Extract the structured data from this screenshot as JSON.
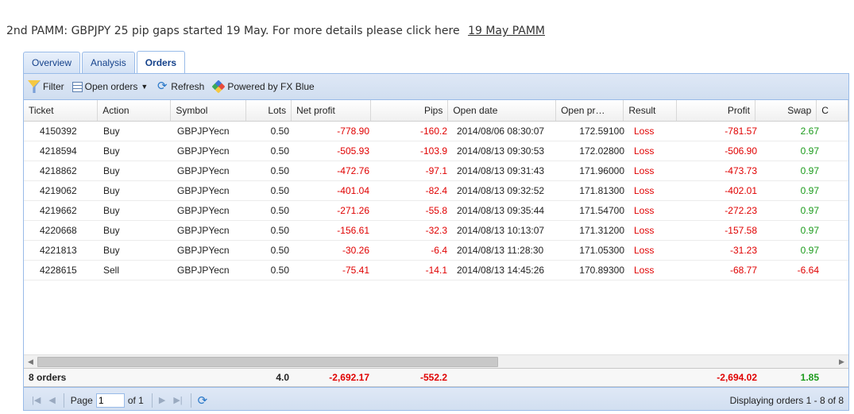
{
  "headline": {
    "text": "2nd PAMM: GBPJPY 25 pip gaps started 19 May. For more details please click here",
    "link": "19 May PAMM"
  },
  "tabs": [
    {
      "label": "Overview"
    },
    {
      "label": "Analysis"
    },
    {
      "label": "Orders",
      "active": true
    }
  ],
  "toolbar": {
    "filter": "Filter",
    "open_orders": "Open orders",
    "refresh": "Refresh",
    "powered": "Powered by FX Blue"
  },
  "columns": {
    "ticket": "Ticket",
    "action": "Action",
    "symbol": "Symbol",
    "lots": "Lots",
    "net_profit": "Net profit",
    "pips": "Pips",
    "open_date": "Open date",
    "open_price": "Open pr…",
    "result": "Result",
    "profit": "Profit",
    "swap": "Swap",
    "c": "C"
  },
  "rows": [
    {
      "ticket": "4150392",
      "action": "Buy",
      "symbol": "GBPJPYecn",
      "lots": "0.50",
      "net_profit": "-778.90",
      "pips": "-160.2",
      "open_date": "2014/08/06 08:30:07",
      "open_price": "172.59100",
      "result": "Loss",
      "profit": "-781.57",
      "swap": "2.67"
    },
    {
      "ticket": "4218594",
      "action": "Buy",
      "symbol": "GBPJPYecn",
      "lots": "0.50",
      "net_profit": "-505.93",
      "pips": "-103.9",
      "open_date": "2014/08/13 09:30:53",
      "open_price": "172.02800",
      "result": "Loss",
      "profit": "-506.90",
      "swap": "0.97"
    },
    {
      "ticket": "4218862",
      "action": "Buy",
      "symbol": "GBPJPYecn",
      "lots": "0.50",
      "net_profit": "-472.76",
      "pips": "-97.1",
      "open_date": "2014/08/13 09:31:43",
      "open_price": "171.96000",
      "result": "Loss",
      "profit": "-473.73",
      "swap": "0.97"
    },
    {
      "ticket": "4219062",
      "action": "Buy",
      "symbol": "GBPJPYecn",
      "lots": "0.50",
      "net_profit": "-401.04",
      "pips": "-82.4",
      "open_date": "2014/08/13 09:32:52",
      "open_price": "171.81300",
      "result": "Loss",
      "profit": "-402.01",
      "swap": "0.97"
    },
    {
      "ticket": "4219662",
      "action": "Buy",
      "symbol": "GBPJPYecn",
      "lots": "0.50",
      "net_profit": "-271.26",
      "pips": "-55.8",
      "open_date": "2014/08/13 09:35:44",
      "open_price": "171.54700",
      "result": "Loss",
      "profit": "-272.23",
      "swap": "0.97"
    },
    {
      "ticket": "4220668",
      "action": "Buy",
      "symbol": "GBPJPYecn",
      "lots": "0.50",
      "net_profit": "-156.61",
      "pips": "-32.3",
      "open_date": "2014/08/13 10:13:07",
      "open_price": "171.31200",
      "result": "Loss",
      "profit": "-157.58",
      "swap": "0.97"
    },
    {
      "ticket": "4221813",
      "action": "Buy",
      "symbol": "GBPJPYecn",
      "lots": "0.50",
      "net_profit": "-30.26",
      "pips": "-6.4",
      "open_date": "2014/08/13 11:28:30",
      "open_price": "171.05300",
      "result": "Loss",
      "profit": "-31.23",
      "swap": "0.97"
    },
    {
      "ticket": "4228615",
      "action": "Sell",
      "symbol": "GBPJPYecn",
      "lots": "0.50",
      "net_profit": "-75.41",
      "pips": "-14.1",
      "open_date": "2014/08/13 14:45:26",
      "open_price": "170.89300",
      "result": "Loss",
      "profit": "-68.77",
      "swap": "-6.64"
    }
  ],
  "summary": {
    "orders": "8 orders",
    "lots": "4.0",
    "net_profit": "-2,692.17",
    "pips": "-552.2",
    "profit": "-2,694.02",
    "swap": "1.85"
  },
  "pager": {
    "page_label": "Page",
    "page_value": "1",
    "of_label": "of 1",
    "display": "Displaying orders 1 - 8 of 8"
  },
  "colors": {
    "negative": "#e00000",
    "positive": "#1a9a1a",
    "border": "#99bbe8",
    "tab_text": "#15428b"
  }
}
